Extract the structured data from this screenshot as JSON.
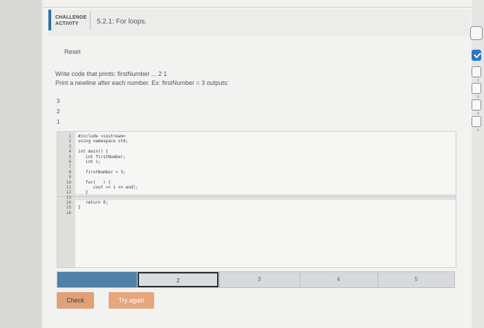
{
  "header": {
    "activity_type": "CHALLENGE ACTIVITY",
    "title": "5.2.1: For loops."
  },
  "reset_label": "Reset",
  "instructions": {
    "line1": "Write code that prints: firstNumber ... 2 1",
    "line2": "Print a newline after each number. Ex: firstNumber = 3 outputs:"
  },
  "example_output": [
    "3",
    "2",
    "1"
  ],
  "code_lines": [
    {
      "n": "1",
      "text": "#include <iostream>"
    },
    {
      "n": "2",
      "text": "using namespace std;"
    },
    {
      "n": "3",
      "text": ""
    },
    {
      "n": "4",
      "text": "int main() {"
    },
    {
      "n": "5",
      "text": "   int firstNumber;"
    },
    {
      "n": "6",
      "text": "   int i;"
    },
    {
      "n": "7",
      "text": ""
    },
    {
      "n": "8",
      "text": "   firstNumber = 3;"
    },
    {
      "n": "9",
      "text": ""
    },
    {
      "n": "10",
      "text": "   for(   ) {"
    },
    {
      "n": "11",
      "text": "      cout << i << endl;"
    },
    {
      "n": "12",
      "text": "   }"
    },
    {
      "n": "13",
      "text": ""
    },
    {
      "n": "14",
      "text": "   return 0;"
    },
    {
      "n": "15",
      "text": "}"
    },
    {
      "n": "16",
      "text": ""
    }
  ],
  "progress": {
    "segments": [
      "",
      "2",
      "3",
      "4",
      "5"
    ],
    "current": 2
  },
  "buttons": {
    "check": "Check",
    "try_again": "Try again"
  },
  "level_icons": [
    "level-1-complete-icon",
    "level-2-icon",
    "level-3-icon",
    "level-4-icon",
    "level-5-icon"
  ],
  "level_numbers": [
    "1",
    "2",
    "3",
    "4",
    "5"
  ],
  "colors": {
    "accent": "#2c6fa3",
    "progress_fill": "#4e80a8",
    "check_button": "#e0a07a",
    "try_again_button": "#e6a77f",
    "level_done": "#2b77c2"
  }
}
